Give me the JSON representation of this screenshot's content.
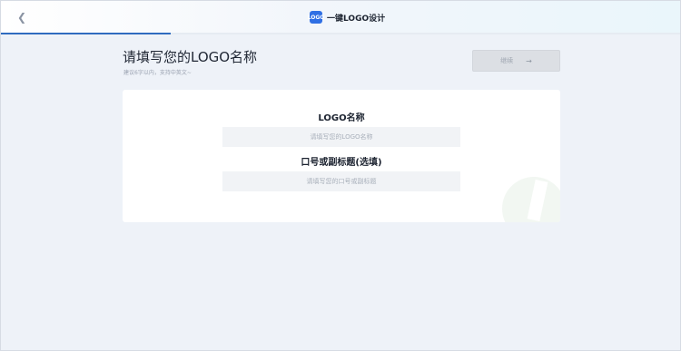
{
  "header": {
    "back_icon": "chevron-left-icon",
    "brand_logo_text": "LOGO",
    "brand_title": "一键LOGO设计",
    "progress_fraction": 0.25,
    "progress_color": "#2f6bbf"
  },
  "main": {
    "title": "请填写您的LOGO名称",
    "subtitle": "建议6字以内，支持中英文~",
    "continue_label": "继续",
    "continue_arrow": "→"
  },
  "form": {
    "name_label": "LOGO名称",
    "name_placeholder": "请填写您的LOGO名称",
    "slogan_label": "口号或副标题(选填)",
    "slogan_placeholder": "请填写您的口号或副标题"
  }
}
